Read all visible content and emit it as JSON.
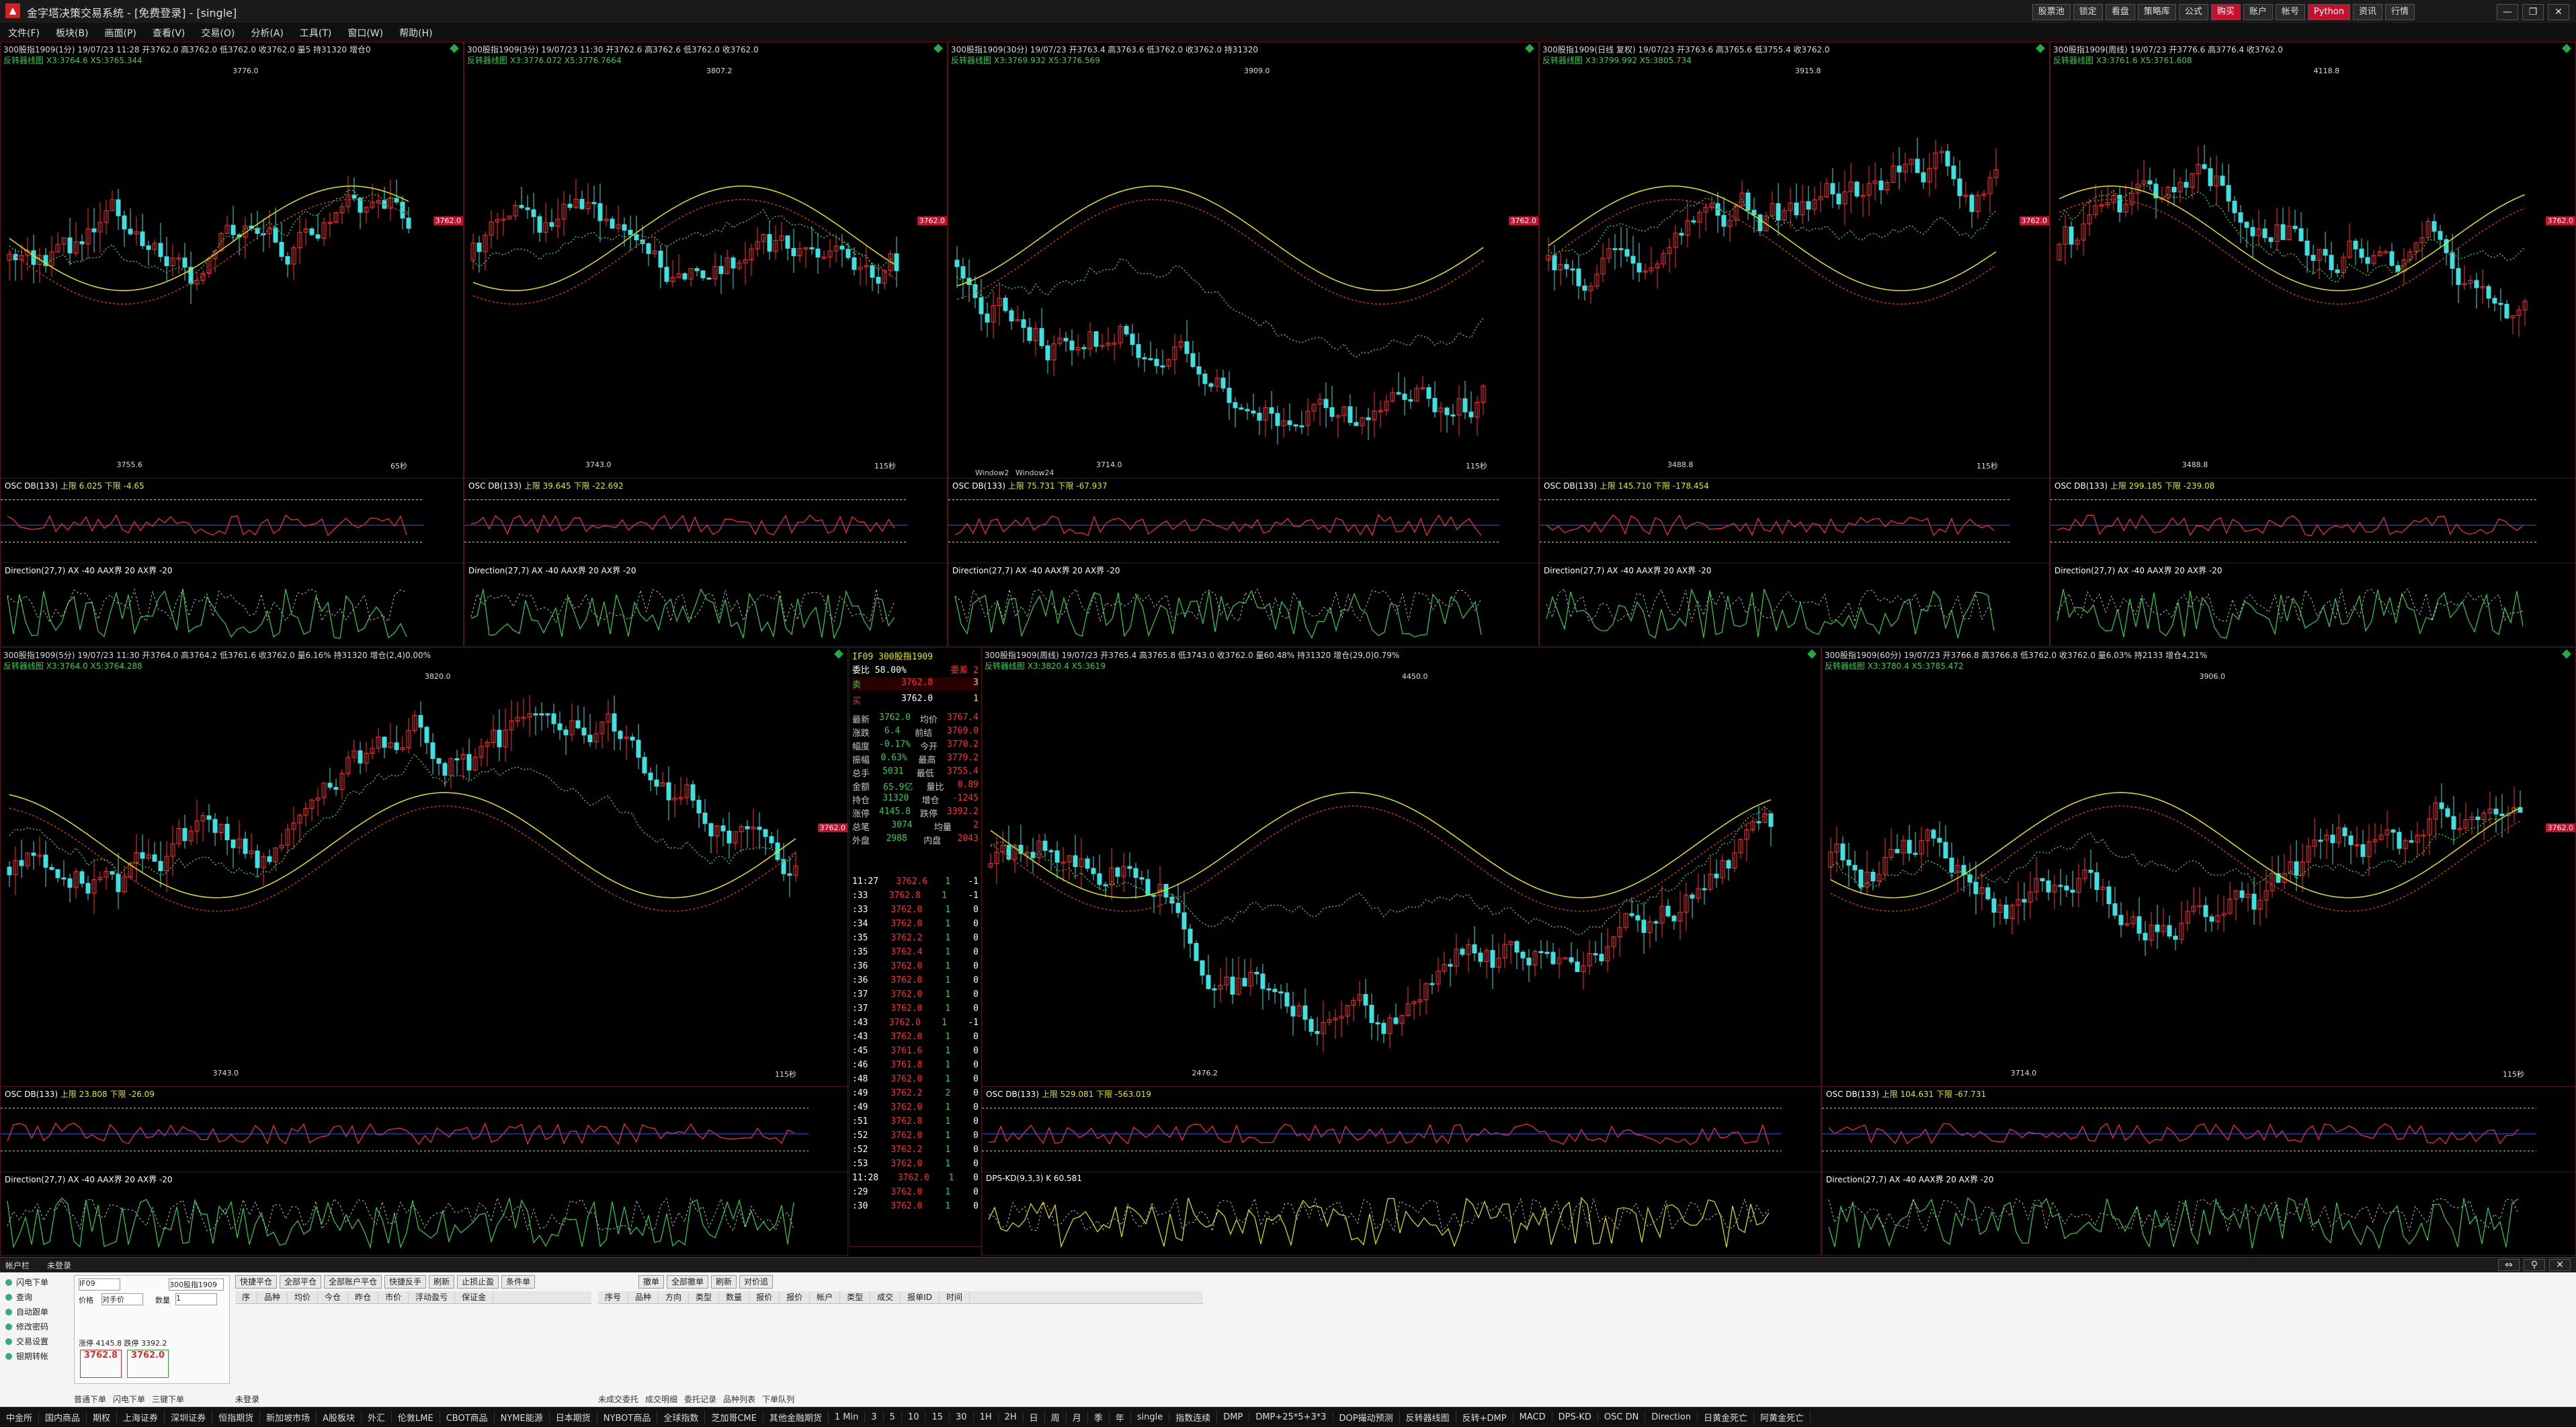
{
  "app": {
    "title": "金字塔决策交易系统 - [免费登录] - [single]",
    "icon_name": "pyramid-app-icon",
    "top_buttons": [
      "股票池",
      "锁定",
      "看盘",
      "策略库",
      "公式",
      "购买",
      "账户",
      "帐号",
      "Python",
      "资讯",
      "行情"
    ],
    "window_controls": [
      "—",
      "❐",
      "✕"
    ]
  },
  "menus": [
    "文件(F)",
    "板块(B)",
    "画面(P)",
    "查看(V)",
    "交易(O)",
    "分析(A)",
    "工具(T)",
    "窗口(W)",
    "帮助(H)"
  ],
  "colors": {
    "up": "#ff3030",
    "down": "#3fe0e0",
    "border": "#5a1010",
    "accent_yellow": "#e6e600",
    "green": "#2fd04a"
  },
  "panels": [
    {
      "head": "300股指1909(1分) 19/07/23 11:28 开3762.0 高3762.0 低3762.0 收3762.0 量5 持31320 增仓0",
      "head2": "反转器线图 X3:3764.6 X5:3765.344",
      "low_label": "3755.6",
      "high_label": "3776.0",
      "period": "65秒",
      "price_tag": "3762.0",
      "osc_head": "OSC DB(133)",
      "osc_vals": "上限 6.025 下限 -4.65",
      "dir_head": "Direction(27,7) AX -40 AAX界 20 AX界 -20"
    },
    {
      "head": "300股指1909(3分) 19/07/23 11:30 开3762.6 高3762.6 低3762.0 收3762.0",
      "head2": "反转器线图 X3:3776.072 X5:3776.7664",
      "low_label": "3743.0",
      "high_label": "3807.2",
      "period": "115秒",
      "price_tag": "3762.0",
      "osc_head": "OSC DB(133)",
      "osc_vals": "上限 39.645 下限 -22.692",
      "dir_head": "Direction(27,7) AX -40 AAX界 20 AX界 -20"
    },
    {
      "head": "300股指1909(30分) 19/07/23 开3763.4 高3763.6 低3762.0 收3762.0 持31320",
      "head2": "反转器线图 X3:3769.932 X5:3776.569",
      "low_label": "3714.0",
      "high_label": "3909.0",
      "period": "115秒",
      "price_tag": "3762.0",
      "osc_head": "OSC DB(133)",
      "osc_vals": "上限 75.731 下限 -67.937",
      "dir_head": "Direction(27,7) AX -40 AAX界 20 AX界 -20",
      "windows": [
        "Window2",
        "Window24"
      ]
    },
    {
      "head": "300股指1909(日线 复权) 19/07/23 开3763.6 高3765.6 低3755.4 收3762.0",
      "head2": "反转器线图 X3:3799.992 X5:3805.734",
      "low_label": "3488.8",
      "high_label": "3915.8",
      "period": "115秒",
      "price_tag": "3762.0",
      "osc_head": "OSC DB(133)",
      "osc_vals": "上限 145.710 下限 -178.454",
      "dir_head": "Direction(27,7) AX -40 AAX界 20 AX界 -20"
    },
    {
      "head": "300股指1909(周线) 19/07/23 开3776.6 高3776.4 收3762.0",
      "head2": "反转器线图 X3:3761.6 X5:3761.608",
      "low_label": "3488.8",
      "high_label": "4118.8",
      "period": "",
      "price_tag": "3762.0",
      "osc_head": "OSC DB(133)",
      "osc_vals": "上限 299.185 下限 -239.08",
      "dir_head": "Direction(27,7) AX -40 AAX界 20 AX界 -20"
    },
    {
      "head": "300股指1909(5分) 19/07/23 11:30 开3764.0 高3764.2 低3761.6 收3762.0 量6.16% 持31320 增仓(2,4)0.00%",
      "head2": "反转器线图 X3:3764.0 X5:3764.288",
      "low_label": "3743.0",
      "high_label": "3820.0",
      "period": "115秒",
      "price_tag": "3762.0",
      "osc_head": "OSC DB(133)",
      "osc_vals": "上限 23.808 下限 -26.09",
      "dir_head": "Direction(27,7) AX -40 AAX界 20 AX界 -20"
    },
    {
      "head": "300股指1909(周线) 19/07/23 开3765.4 高3765.8 低3743.0 收3762.0 量60.48% 持31320 增仓(29,0)0.79%",
      "head2": "反转器线图 X3:3820.4 X5:3619",
      "low_label": "2476.2",
      "high_label": "4450.0",
      "period": "",
      "price_tag": "",
      "osc_head": "OSC DB(133)",
      "osc_vals": "上限 529.081 下限 -563.019",
      "dir_head": "DPS-KD(9,3,3) K 60.581"
    },
    {
      "head": "300股指1909(60分) 19/07/23 开3766.8 高3766.8 低3762.0 收3762.0 量6.03% 持2133 增仓4,21%",
      "head2": "反转器线图 X3:3780.4 X5:3785.472",
      "low_label": "3714.0",
      "high_label": "3906.0",
      "period": "115秒",
      "price_tag": "3762.0",
      "osc_head": "OSC DB(133)",
      "osc_vals": "上限 104.631 下限 -67.731",
      "dir_head": "Direction(27,7) AX -40 AAX界 20 AX界 -20"
    }
  ],
  "quote": {
    "symbol": "IF09 300股指1909",
    "webi": "委比 58.00%",
    "weicha": "委差 2",
    "sell_price": "3762.8",
    "sell_vol": "3",
    "buy_price": "3762.0",
    "buy_vol": "1",
    "rows": [
      [
        "最新",
        "3762.0",
        "均价",
        "3767.4"
      ],
      [
        "涨跌",
        "6.4",
        "前结",
        "3769.0"
      ],
      [
        "幅度",
        "-0.17%",
        "今开",
        "3770.2"
      ],
      [
        "振幅",
        "0.63%",
        "最高",
        "3779.2"
      ],
      [
        "总手",
        "5031",
        "最低",
        "3755.4"
      ],
      [
        "金额",
        "65.9亿",
        "量比",
        "0.89"
      ],
      [
        "持仓",
        "31320",
        "增仓",
        "-1245"
      ],
      [
        "涨停",
        "4145.8",
        "跌停",
        "3392.2"
      ],
      [
        "总笔",
        "3074",
        "均量",
        "2"
      ],
      [
        "外盘",
        "2988",
        "内盘",
        "2043"
      ]
    ],
    "ticks": [
      [
        "11:27",
        "3762.6",
        "1",
        "-1"
      ],
      [
        ":33",
        "3762.8",
        "1",
        "-1"
      ],
      [
        ":33",
        "3762.0",
        "1",
        "0"
      ],
      [
        ":34",
        "3762.0",
        "1",
        "0"
      ],
      [
        ":35",
        "3762.2",
        "1",
        "0"
      ],
      [
        ":35",
        "3762.4",
        "1",
        "0"
      ],
      [
        ":36",
        "3762.0",
        "1",
        "0"
      ],
      [
        ":36",
        "3762.0",
        "1",
        "0"
      ],
      [
        ":37",
        "3762.0",
        "1",
        "0"
      ],
      [
        ":37",
        "3762.0",
        "1",
        "0"
      ],
      [
        ":43",
        "3762.0",
        "1",
        "-1"
      ],
      [
        ":43",
        "3762.0",
        "1",
        "0"
      ],
      [
        ":45",
        "3761.6",
        "1",
        "0"
      ],
      [
        ":46",
        "3761.8",
        "1",
        "0"
      ],
      [
        ":48",
        "3762.0",
        "1",
        "0"
      ],
      [
        ":49",
        "3762.2",
        "2",
        "0"
      ],
      [
        ":49",
        "3762.0",
        "1",
        "0"
      ],
      [
        ":51",
        "3762.8",
        "1",
        "0"
      ],
      [
        ":52",
        "3762.0",
        "1",
        "0"
      ],
      [
        ":52",
        "3762.2",
        "1",
        "0"
      ],
      [
        ":53",
        "3762.0",
        "1",
        "0"
      ],
      [
        "11:28",
        "3762.0",
        "1",
        "0"
      ],
      [
        ":29",
        "3762.0",
        "1",
        "0"
      ],
      [
        ":30",
        "3762.0",
        "1",
        "0"
      ]
    ]
  },
  "trade": {
    "bar_tabs": [
      "帐户栏",
      "未登录"
    ],
    "leftnav": [
      "闪电下单",
      "查询",
      "自动跟单",
      "修改密码",
      "交易设置",
      "银期转帐"
    ],
    "symbol": "IF09",
    "contract": "300股指1909",
    "price_label": "价格",
    "price_type": "对手价",
    "qty_label": "数量",
    "qty": "1",
    "avail": "涨停 4145.8 跌停 3392.2",
    "sell_price": "3762.8",
    "buy_price": "3762.0",
    "action_buttons": [
      "快捷平仓",
      "全部平仓",
      "全部账户平仓",
      "快捷反手",
      "刷新",
      "止损止盈",
      "条件单"
    ],
    "right_buttons": [
      "撤单",
      "全部撤单",
      "刷新",
      "对价追"
    ],
    "pos_columns": [
      "序",
      "品种",
      "均价",
      "今仓",
      "昨仓",
      "市价",
      "浮动盈亏",
      "保证金"
    ],
    "order_columns": [
      "序号",
      "品种",
      "方向",
      "类型",
      "数量",
      "报价",
      "报价",
      "帐户",
      "类型",
      "成交",
      "报单ID",
      "时间"
    ],
    "bottom_tabs_left": [
      "普通下单",
      "闪电下单",
      "三键下单"
    ],
    "bottom_tabs_right": [
      "未成交委托",
      "成交明细",
      "委托记录",
      "品种列表",
      "下单队列"
    ],
    "status_text": "未登录"
  },
  "statusbar": [
    "中金所",
    "国内商品",
    "期权",
    "上海证券",
    "深圳证券",
    "恒指期货",
    "新加坡市场",
    "A股板块",
    "外汇",
    "伦敦LME",
    "CBOT商品",
    "NYME能源",
    "日本期货",
    "NYBOT商品",
    "全球指数",
    "芝加哥CME",
    "其他金融期货",
    "1 Min",
    "3",
    "5",
    "10",
    "15",
    "30",
    "1H",
    "2H",
    "日",
    "周",
    "月",
    "季",
    "年",
    "single",
    "指数连续",
    "DMP",
    "DMP+25*5+3*3",
    "DOP撮动预测",
    "反转器线图",
    "反转+DMP",
    "MACD",
    "DPS-KD",
    "OSC DN",
    "Direction",
    "日黄金死亡",
    "阿黄金死亡"
  ]
}
